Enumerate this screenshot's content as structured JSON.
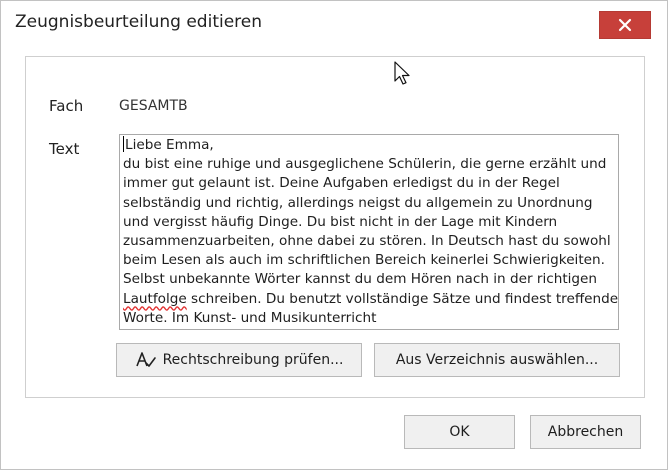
{
  "window": {
    "title": "Zeugnisbeurteilung editieren"
  },
  "form": {
    "fach_label": "Fach",
    "fach_value": "GESAMTB",
    "text_label": "Text",
    "text_greeting": "Liebe Emma,",
    "text_before_misspelling": "du bist eine ruhige und ausgeglichene Schülerin, die gerne erzählt und immer gut gelaunt ist. Deine Aufgaben erledigst du in der Regel selbständig und richtig, allerdings neigst du allgemein zu Unordnung und vergisst häufig Dinge. Du bist nicht in der Lage mit Kindern zusammenzuarbeiten, ohne dabei zu stören. In Deutsch hast du sowohl beim Lesen als auch im schriftlichen Bereich keinerlei Schwierigkeiten. Selbst unbekannte Wörter kannst du dem Hören nach in der richtigen ",
    "text_misspelled_word": "Lautfolge",
    "text_after_misspelling": " schreiben. Du benutzt vollständige Sätze und findest treffende Worte. Im Kunst- und Musikunterricht"
  },
  "buttons": {
    "spellcheck_label": "Rechtschreibung prüfen...",
    "directory_label": "Aus Verzeichnis auswählen...",
    "ok_label": "OK",
    "cancel_label": "Abbrechen"
  },
  "icons": {
    "close": "close-icon",
    "spellcheck": "spellcheck-icon",
    "cursor": "mouse-pointer-icon"
  },
  "colors": {
    "close_button": "#c7403a",
    "spell_underline": "#e23030"
  }
}
